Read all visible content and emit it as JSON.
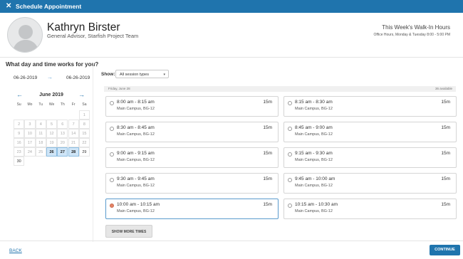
{
  "window": {
    "title": "Schedule Appointment",
    "close_glyph": "✕"
  },
  "advisor": {
    "name": "Kathryn Birster",
    "title": "General Advisor, Starfish Project Team"
  },
  "walkin": {
    "title": "This Week's Walk-In Hours",
    "hours": "Office Hours, Monday & Tuesday 8:00 - 5:00 PM"
  },
  "question": "What day and time works for you?",
  "date_range": {
    "from": "06-26-2019",
    "arrow": "→",
    "to": "06-26-2019"
  },
  "calendar": {
    "prev": "←",
    "next": "→",
    "month": "June 2019",
    "weekdays": [
      "Su",
      "Mo",
      "Tu",
      "We",
      "Th",
      "Fr",
      "Sa"
    ],
    "weeks": [
      [
        "",
        "",
        "",
        "",
        "",
        "",
        "1"
      ],
      [
        "2",
        "3",
        "4",
        "5",
        "6",
        "7",
        "8"
      ],
      [
        "9",
        "10",
        "11",
        "12",
        "13",
        "14",
        "15"
      ],
      [
        "16",
        "17",
        "18",
        "19",
        "20",
        "21",
        "22"
      ],
      [
        "23",
        "24",
        "25",
        "26",
        "27",
        "28",
        "29"
      ],
      [
        "30",
        "",
        "",
        "",
        "",
        "",
        ""
      ]
    ],
    "selected_days": [
      "26",
      "27",
      "28"
    ],
    "available_days": [
      "29",
      "30"
    ]
  },
  "filter": {
    "label": "Show:",
    "value": "All session types",
    "caret": "▾"
  },
  "day_band": {
    "date": "Friday, June 28",
    "available": "36 available"
  },
  "slots": [
    {
      "time": "8:00 am - 8:15 am",
      "location": "Main Campus, BG-12",
      "duration": "15m",
      "selected": false
    },
    {
      "time": "8:15 am - 8:30 am",
      "location": "Main Campus, BG-12",
      "duration": "15m",
      "selected": false
    },
    {
      "time": "8:30 am - 8:45 am",
      "location": "Main Campus, BG-12",
      "duration": "15m",
      "selected": false
    },
    {
      "time": "8:45 am - 9:00 am",
      "location": "Main Campus, BG-12",
      "duration": "15m",
      "selected": false
    },
    {
      "time": "9:00 am - 9:15 am",
      "location": "Main Campus, BG-12",
      "duration": "15m",
      "selected": false
    },
    {
      "time": "9:15 am - 9:30 am",
      "location": "Main Campus, BG-12",
      "duration": "15m",
      "selected": false
    },
    {
      "time": "9:30 am - 9:45 am",
      "location": "Main Campus, BG-12",
      "duration": "15m",
      "selected": false
    },
    {
      "time": "9:45 am - 10:00 am",
      "location": "Main Campus, BG-12",
      "duration": "15m",
      "selected": false
    },
    {
      "time": "10:00 am - 10:15 am",
      "location": "Main Campus, BG-12",
      "duration": "15m",
      "selected": true
    },
    {
      "time": "10:15 am - 10:30 am",
      "location": "Main Campus, BG-12",
      "duration": "15m",
      "selected": false
    }
  ],
  "buttons": {
    "show_more": "SHOW MORE TIMES",
    "back": "BACK",
    "continue": "CONTINUE"
  },
  "colors": {
    "brand": "#1f74ad",
    "selected_day": "#cfe5f7",
    "selected_radio": "#e58466"
  }
}
